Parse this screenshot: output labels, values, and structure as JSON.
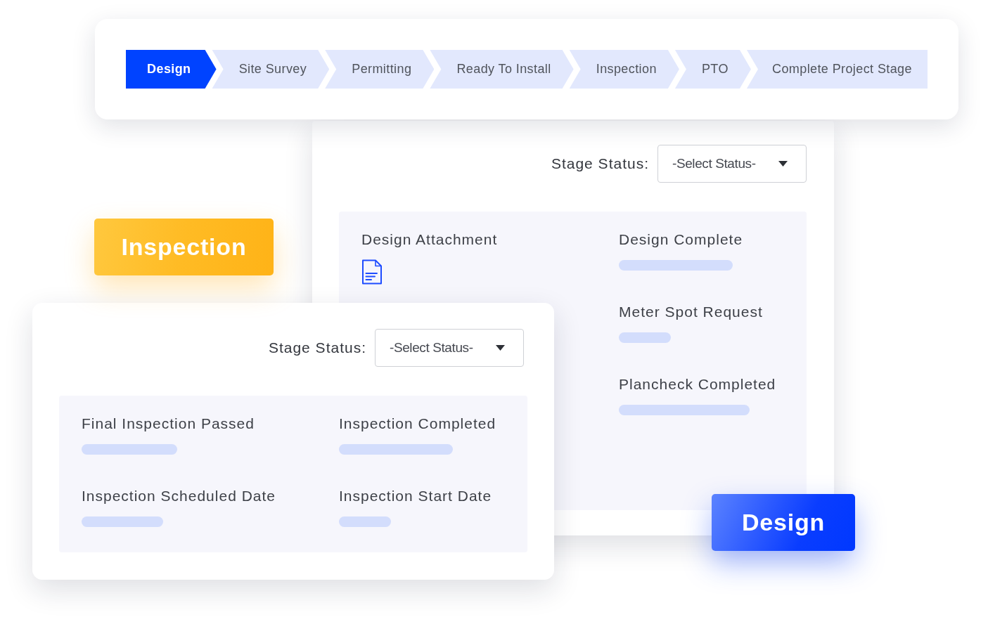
{
  "stage_bar": {
    "steps": [
      {
        "label": "Design",
        "selected": true
      },
      {
        "label": "Site Survey",
        "selected": false
      },
      {
        "label": "Permitting",
        "selected": false
      },
      {
        "label": "Ready To Install",
        "selected": false
      },
      {
        "label": "Inspection",
        "selected": false
      },
      {
        "label": "PTO",
        "selected": false
      },
      {
        "label": "Complete Project Stage",
        "selected": false
      }
    ]
  },
  "stage_cards": [
    {
      "kind": "design",
      "status_label": "Stage Status:",
      "status_placeholder": "-Select Status-",
      "columns": [
        [
          {
            "label": "Design Attachment",
            "kind": "attachment"
          }
        ],
        [
          {
            "label": "Design Complete",
            "kind": "pending"
          },
          {
            "label": "Meter Spot Request",
            "kind": "pending"
          },
          {
            "label": "Plancheck Completed",
            "kind": "pending"
          }
        ]
      ],
      "tag": "Design"
    },
    {
      "kind": "inspection",
      "tag": "Inspection",
      "status_label": "Stage Status:",
      "status_placeholder": "-Select Status-",
      "columns": [
        [
          {
            "label": "Final Inspection Passed",
            "kind": "pending"
          },
          {
            "label": "Inspection Scheduled Date",
            "kind": "pending"
          }
        ],
        [
          {
            "label": "Inspection Completed",
            "kind": "pending"
          },
          {
            "label": "Inspection Start Date",
            "kind": "pending"
          }
        ]
      ]
    }
  ]
}
